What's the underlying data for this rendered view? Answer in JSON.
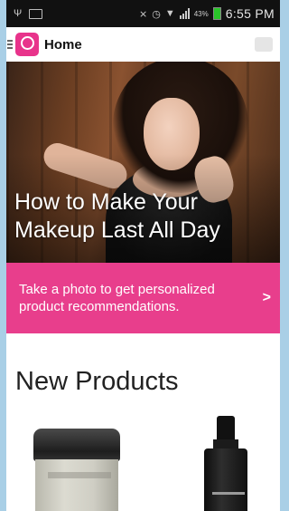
{
  "status_bar": {
    "time": "6:55 PM",
    "battery_percent": "43%",
    "icons": [
      "usb-icon",
      "notification-icon",
      "mute-icon",
      "alarm-icon",
      "wifi-icon",
      "signal-icon",
      "battery-icon"
    ]
  },
  "app_bar": {
    "title": "Home",
    "logo_icon": "mirror-logo-icon",
    "menu_icon": "hamburger-menu-icon",
    "action_icon": "chat-icon"
  },
  "hero": {
    "title": "How to Make Your Makeup Last All Day"
  },
  "cta": {
    "text": "Take a photo to get personalized product recommendations.",
    "chevron": ">"
  },
  "new_products": {
    "title": "New Products",
    "items": [
      {
        "image": "skincare-jar"
      },
      {
        "image": "serum-bottle"
      }
    ]
  },
  "colors": {
    "accent_pink": "#e83e8c",
    "status_bar_bg": "#111111",
    "page_bg": "#ffffff"
  }
}
